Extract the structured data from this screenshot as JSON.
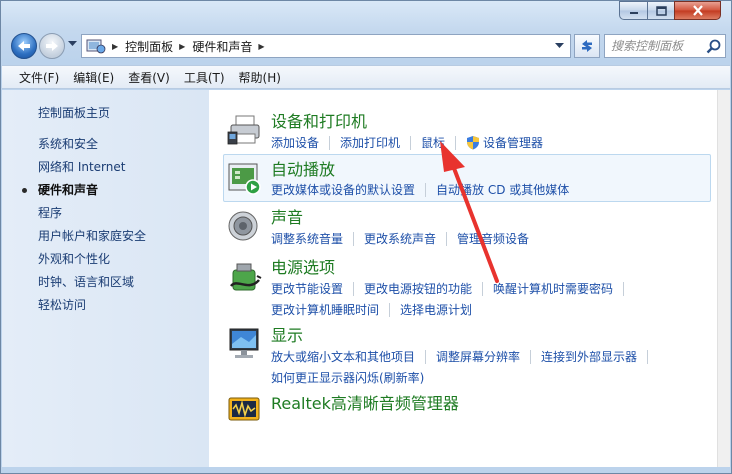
{
  "window": {
    "caption_icons": {
      "minimize": "minimize-icon",
      "maximize": "maximize-icon",
      "close": "close-icon"
    }
  },
  "address": {
    "breadcrumbs": [
      "控制面板",
      "硬件和声音"
    ],
    "search_placeholder": "搜索控制面板"
  },
  "menu": [
    "文件(F)",
    "编辑(E)",
    "查看(V)",
    "工具(T)",
    "帮助(H)"
  ],
  "sidebar": {
    "home": "控制面板主页",
    "items": [
      {
        "label": "系统和安全",
        "active": false
      },
      {
        "label": "网络和 Internet",
        "active": false
      },
      {
        "label": "硬件和声音",
        "active": true
      },
      {
        "label": "程序",
        "active": false
      },
      {
        "label": "用户帐户和家庭安全",
        "active": false
      },
      {
        "label": "外观和个性化",
        "active": false
      },
      {
        "label": "时钟、语言和区域",
        "active": false
      },
      {
        "label": "轻松访问",
        "active": false
      }
    ]
  },
  "categories": [
    {
      "title": "设备和打印机",
      "icon": "printer-icon",
      "lines": [
        [
          "添加设备",
          "添加打印机",
          "鼠标",
          "设备管理器"
        ]
      ]
    },
    {
      "title": "自动播放",
      "icon": "autoplay-icon",
      "lines": [
        [
          "更改媒体或设备的默认设置",
          "自动播放 CD 或其他媒体"
        ]
      ]
    },
    {
      "title": "声音",
      "icon": "speaker-icon",
      "lines": [
        [
          "调整系统音量",
          "更改系统声音",
          "管理音频设备"
        ]
      ]
    },
    {
      "title": "电源选项",
      "icon": "power-options-icon",
      "lines": [
        [
          "更改节能设置",
          "更改电源按钮的功能",
          "唤醒计算机时需要密码"
        ],
        [
          "更改计算机睡眠时间",
          "选择电源计划"
        ]
      ]
    },
    {
      "title": "显示",
      "icon": "display-icon",
      "lines": [
        [
          "放大或缩小文本和其他项目",
          "调整屏幕分辨率",
          "连接到外部显示器"
        ],
        [
          "如何更正显示器闪烁(刷新率)"
        ]
      ]
    },
    {
      "title": "Realtek高清晰音频管理器",
      "icon": "realtek-audio-icon",
      "lines": []
    }
  ],
  "colors": {
    "title_green": "#1e7b22",
    "link_blue": "#1d4fa8",
    "annotation_arrow": "#e8332e"
  }
}
